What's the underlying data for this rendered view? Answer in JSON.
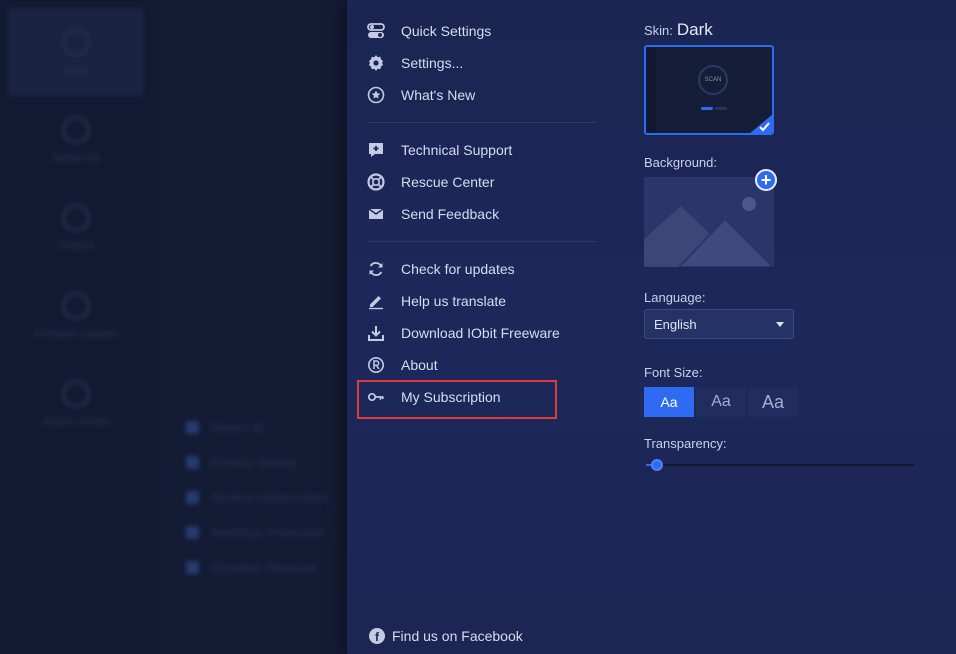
{
  "background_app": {
    "nav_items": [
      "Scan",
      "Speed Up",
      "Protect",
      "Software Updater",
      "Action Center"
    ],
    "check_items": [
      "Detect IE",
      "Privacy Sweep",
      "System Optimization",
      "AntiVirus Protection",
      "Spyware Removal"
    ]
  },
  "menu": {
    "group1": [
      {
        "label": "Quick Settings",
        "icon": "toggles-icon"
      },
      {
        "label": "Settings...",
        "icon": "gear-icon"
      },
      {
        "label": "What's New",
        "icon": "star-circle-icon"
      }
    ],
    "group2": [
      {
        "label": "Technical Support",
        "icon": "support-chat-icon"
      },
      {
        "label": "Rescue Center",
        "icon": "lifebuoy-icon"
      },
      {
        "label": "Send Feedback",
        "icon": "envelope-icon"
      }
    ],
    "group3": [
      {
        "label": "Check for updates",
        "icon": "refresh-icon"
      },
      {
        "label": "Help us translate",
        "icon": "pencil-icon"
      },
      {
        "label": "Download IObit Freeware",
        "icon": "download-icon"
      },
      {
        "label": "About",
        "icon": "registered-icon"
      },
      {
        "label": "My Subscription",
        "icon": "key-icon"
      }
    ],
    "facebook_label": "Find us on Facebook"
  },
  "settings": {
    "skin_label": "Skin:",
    "skin_value": "Dark",
    "skin_preview_text": "SCAN",
    "background_label": "Background:",
    "language_label": "Language:",
    "language_value": "English",
    "font_size_label": "Font Size:",
    "font_sizes": [
      "Aa",
      "Aa",
      "Aa"
    ],
    "font_size_selected": 0,
    "transparency_label": "Transparency:",
    "transparency_value": 0.04
  },
  "colors": {
    "accent": "#2f6bf2",
    "panel_bg": "#1b2654",
    "highlight_border": "#e03a3a"
  }
}
